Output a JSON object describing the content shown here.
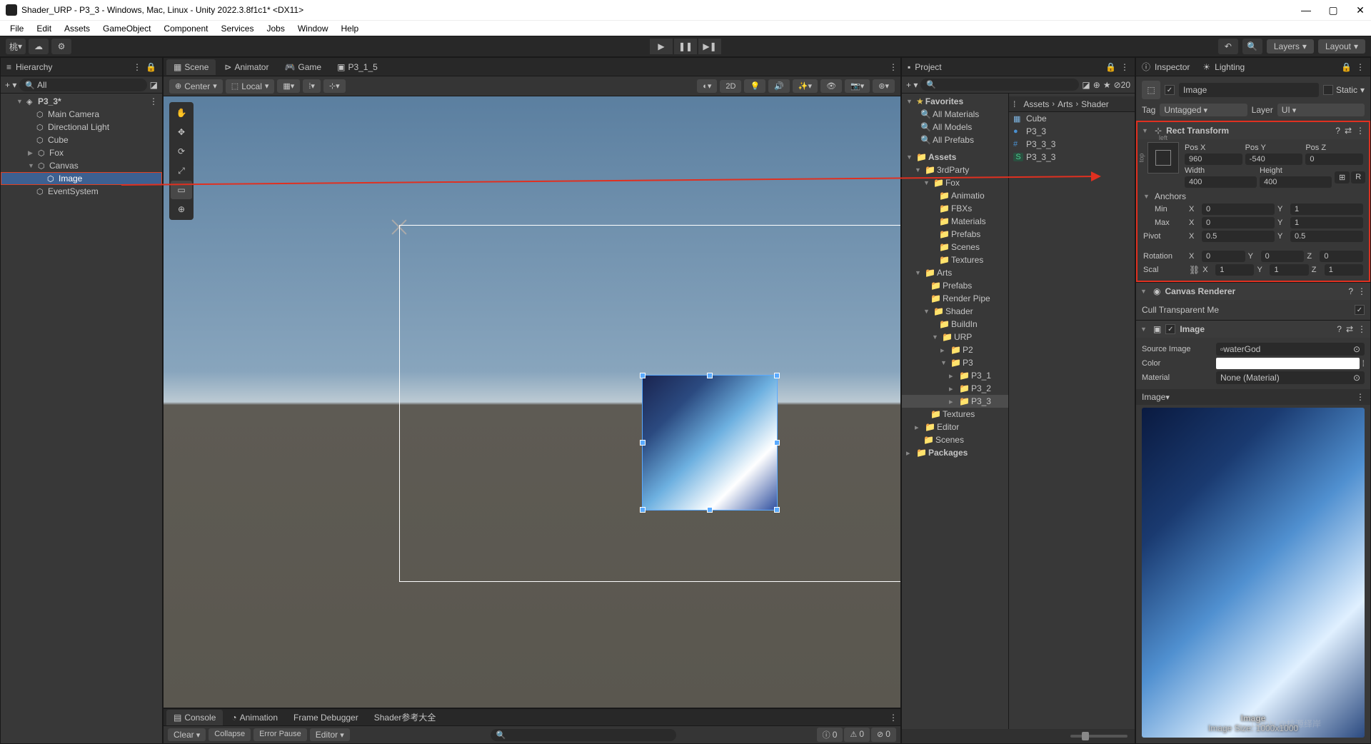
{
  "title": "Shader_URP - P3_3 - Windows, Mac, Linux - Unity 2022.3.8f1c1* <DX11>",
  "menu": [
    "File",
    "Edit",
    "Assets",
    "GameObject",
    "Component",
    "Services",
    "Jobs",
    "Window",
    "Help"
  ],
  "topbar": {
    "account": "桃",
    "layers": "Layers",
    "layout": "Layout"
  },
  "hierarchy": {
    "title": "Hierarchy",
    "search_ph": "All",
    "scene": "P3_3*",
    "items": [
      "Main Camera",
      "Directional Light",
      "Cube",
      "Fox",
      "Canvas",
      "Image",
      "EventSystem"
    ]
  },
  "scene": {
    "tabs": [
      {
        "icon": "▣",
        "label": "Scene",
        "active": true
      },
      {
        "icon": "▶",
        "label": "Animator"
      },
      {
        "icon": "∞",
        "label": "Game"
      },
      {
        "icon": "■",
        "label": "P3_1_5"
      }
    ],
    "pivot": "Center",
    "handle": "Local",
    "twoD": "2D"
  },
  "console": {
    "tabs": [
      {
        "label": "Console",
        "icon": "▤"
      },
      {
        "label": "Animation",
        "icon": "◔"
      },
      {
        "label": "Frame Debugger"
      },
      {
        "label": "Shader参考大全"
      }
    ],
    "clear": "Clear",
    "collapse": "Collapse",
    "errorPause": "Error Pause",
    "editor": "Editor",
    "counts": {
      "info": "0",
      "warn": "0",
      "err": "0"
    }
  },
  "project": {
    "title": "Project",
    "crumbs": [
      "Assets",
      "Arts",
      "Shader"
    ],
    "fav_hdr": "Favorites",
    "favs": [
      "All Materials",
      "All Models",
      "All Prefabs"
    ],
    "tree": {
      "assets": "Assets",
      "thirdp": "3rdParty",
      "fox": "Fox",
      "animation": "Animatio",
      "fbx": "FBXs",
      "materials": "Materials",
      "prefabs": "Prefabs",
      "scenes": "Scenes",
      "textures": "Textures",
      "arts": "Arts",
      "arts_prefabs": "Prefabs",
      "renderpipe": "Render Pipe",
      "shader": "Shader",
      "buildin": "BuildIn",
      "urp": "URP",
      "p2": "P2",
      "p3": "P3",
      "p31": "P3_1",
      "p32": "P3_2",
      "p33": "P3_3",
      "textures2": "Textures",
      "editor": "Editor",
      "scenes2": "Scenes",
      "packages": "Packages"
    },
    "list": [
      {
        "icon": "▦",
        "name": "Cube",
        "color": "#7db4e0"
      },
      {
        "icon": "●",
        "name": "P3_3",
        "color": "#4a90d0"
      },
      {
        "icon": "#",
        "name": "P3_3_3",
        "color": "#4a90d0"
      },
      {
        "icon": "S",
        "name": "P3_3_3",
        "color": "#4ad090"
      }
    ]
  },
  "inspector": {
    "tabs": [
      {
        "label": "Inspector",
        "icon": "ⓘ"
      },
      {
        "label": "Lighting",
        "icon": "☀"
      }
    ],
    "name": "Image",
    "static": "Static",
    "tag_lbl": "Tag",
    "tag": "Untagged",
    "layer_lbl": "Layer",
    "layer": "UI",
    "rect": {
      "title": "Rect Transform",
      "left": "left",
      "top": "top",
      "posx_l": "Pos X",
      "posy_l": "Pos Y",
      "posz_l": "Pos Z",
      "posx": "960",
      "posy": "-540",
      "posz": "0",
      "w_l": "Width",
      "h_l": "Height",
      "w": "400",
      "h": "400",
      "anchors": "Anchors",
      "min": "Min",
      "max": "Max",
      "min_x": "0",
      "min_y": "1",
      "max_x": "0",
      "max_y": "1",
      "pivot": "Pivot",
      "piv_x": "0.5",
      "piv_y": "0.5",
      "rot": "Rotation",
      "rx": "0",
      "ry": "0",
      "rz": "0",
      "scl": "Scal",
      "sx": "1",
      "sy": "1",
      "sz": "1"
    },
    "canvasr": {
      "title": "Canvas Renderer",
      "cull_l": "Cull Transparent Me"
    },
    "image": {
      "title": "Image",
      "src_l": "Source Image",
      "src": "waterGod",
      "color_l": "Color",
      "mat_l": "Material",
      "mat": "None (Material)"
    },
    "preview": {
      "title": "Image",
      "name": "Image",
      "size": "Image Size: 1000x1000"
    }
  },
  "watermark": "CSDN @桃源绎岸"
}
